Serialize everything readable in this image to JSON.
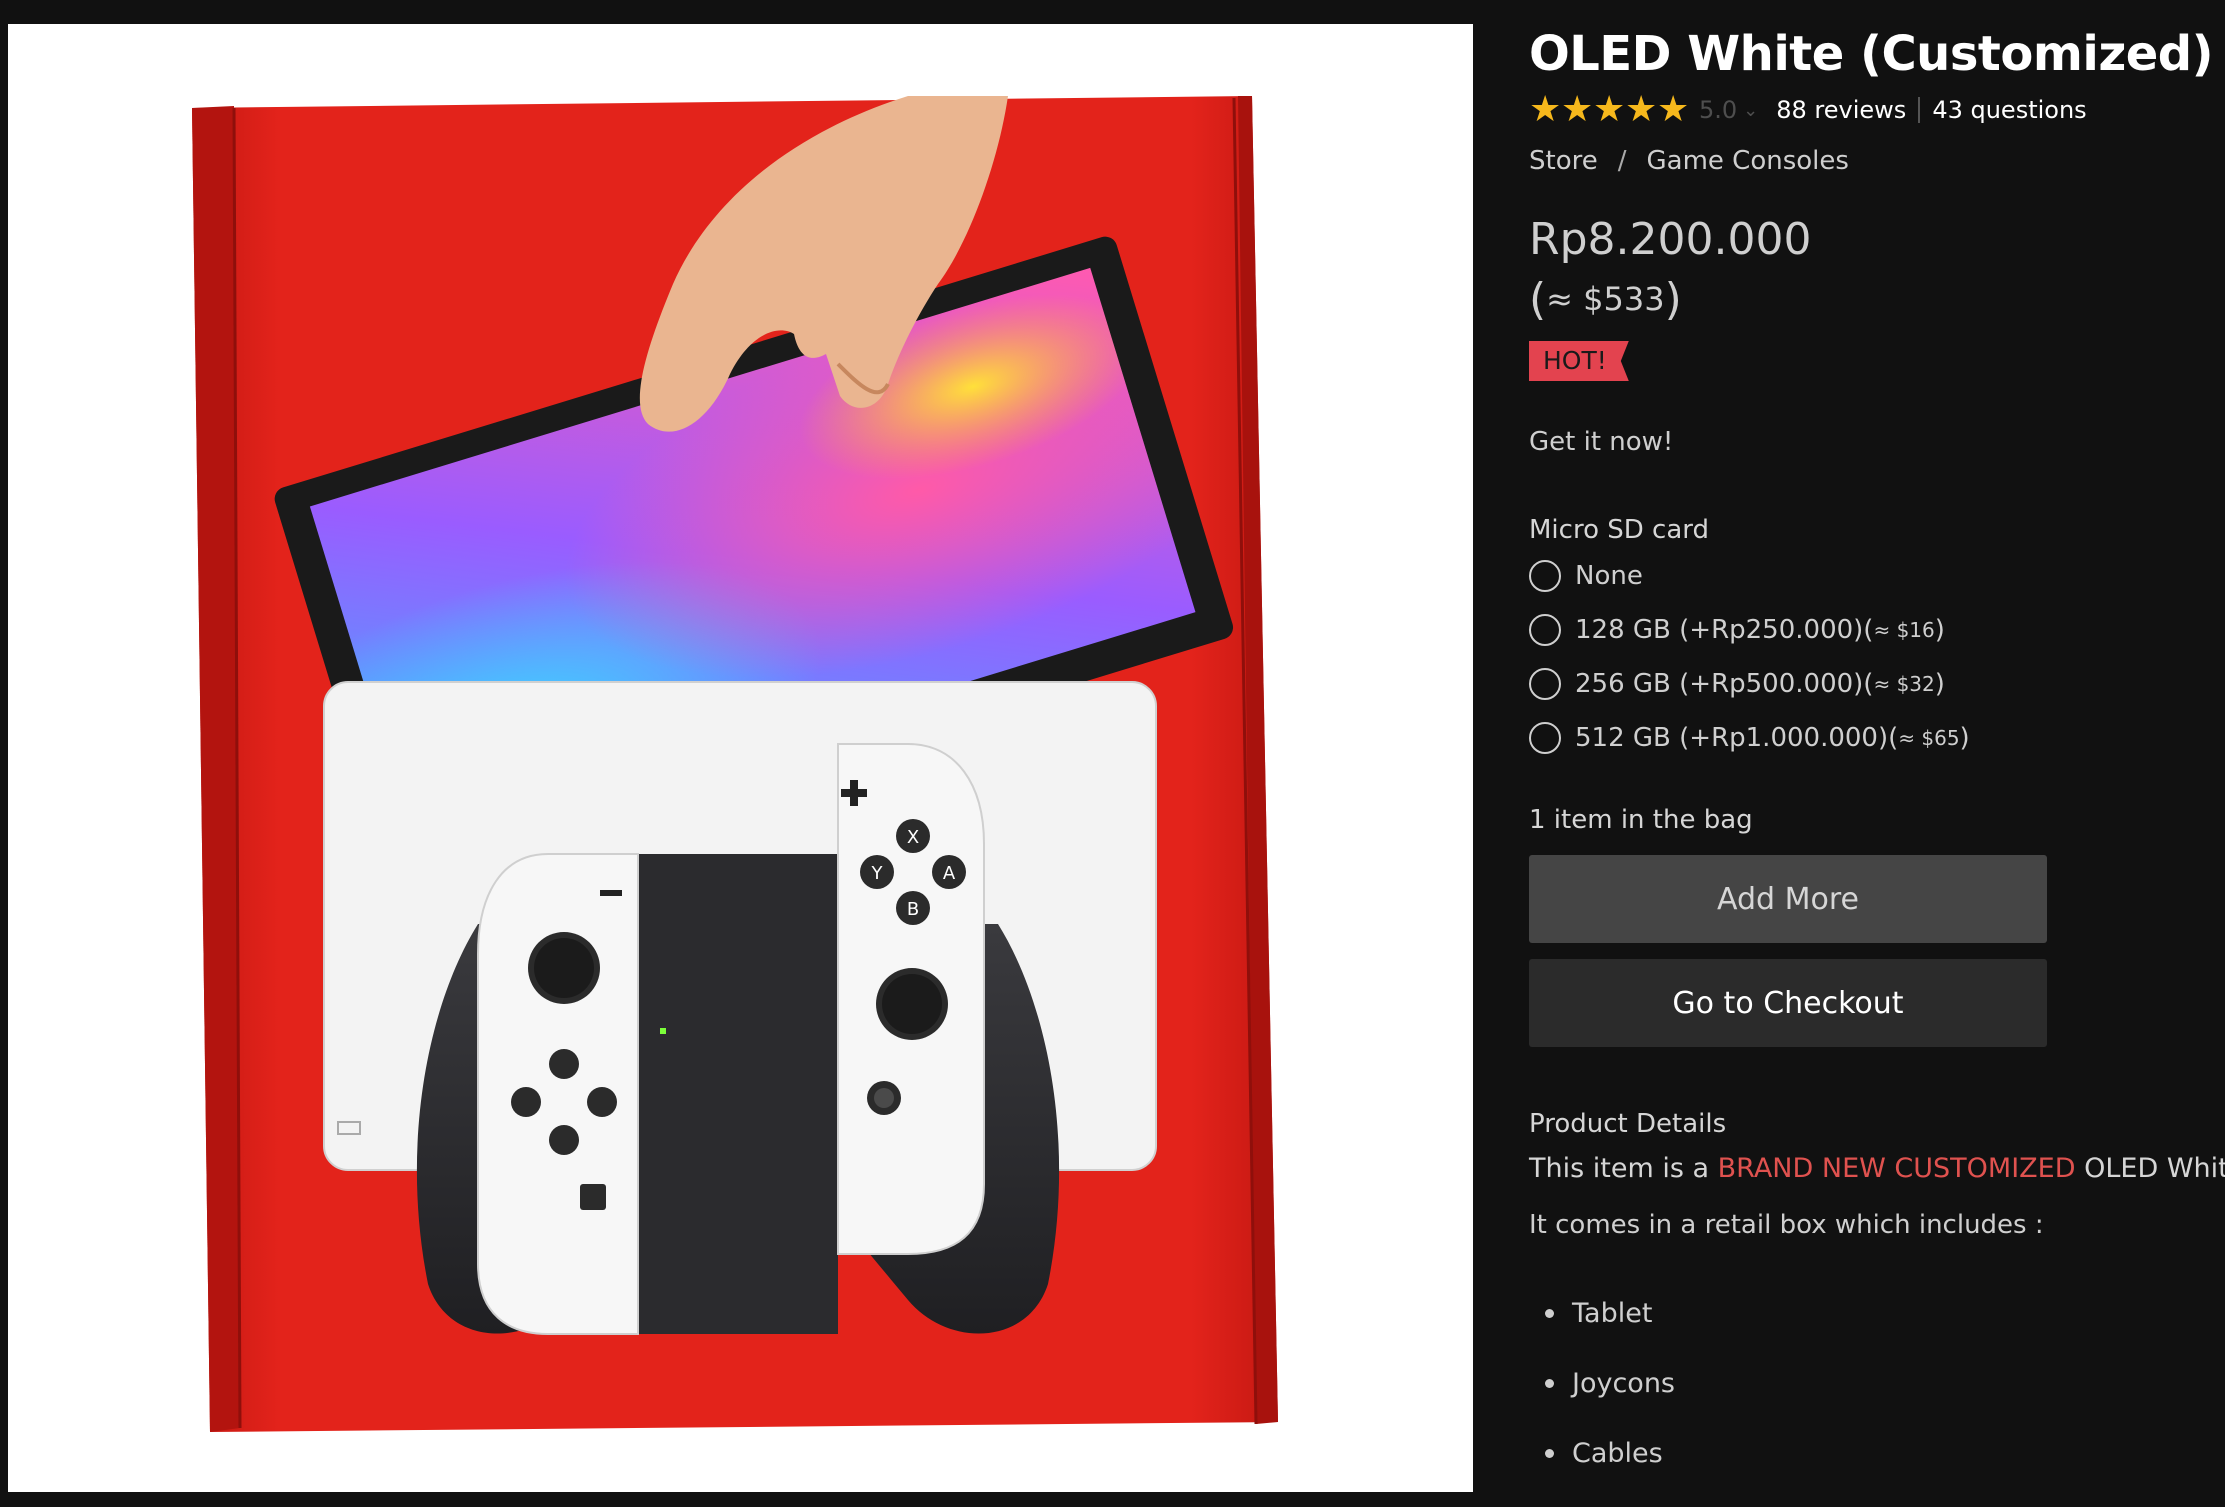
{
  "product": {
    "title": "OLED White (Customized)",
    "rating": {
      "stars_filled": 5,
      "stars_total": 5,
      "value": "5.0",
      "reviews": "88 reviews",
      "questions": "43 questions"
    },
    "breadcrumb": {
      "items": [
        "Store",
        "Game Consoles"
      ],
      "separator": "/"
    },
    "price": "Rp8.200.000",
    "price_usd": {
      "open": "(",
      "approx": "≈ $533",
      "close": ")"
    },
    "badge": "HOT!",
    "tagline": "Get it now!"
  },
  "options": {
    "title": "Micro SD card",
    "items": [
      {
        "label": "None",
        "usd": ""
      },
      {
        "label": "128 GB (+Rp250.000)(",
        "usd": "≈ $16",
        "close": ")"
      },
      {
        "label": "256 GB (+Rp500.000)(",
        "usd": "≈ $32",
        "close": ")"
      },
      {
        "label": "512 GB (+Rp1.000.000)(",
        "usd": "≈ $65",
        "close": ")"
      }
    ],
    "selected": null
  },
  "bag": {
    "count_text": "1 item in the bag",
    "add_more": "Add More",
    "checkout": "Go to Checkout"
  },
  "details": {
    "title": "Product Details",
    "line1_prefix": "This item is a",
    "line1_highlight": "BRAND NEW CUSTOMIZED",
    "line1_suffix": "OLED White.",
    "line2": "It comes in a retail box which includes :",
    "included": [
      "Tablet",
      "Joycons",
      "Cables"
    ]
  },
  "joycon_buttons": {
    "x": "X",
    "y": "Y",
    "a": "A",
    "b": "B"
  },
  "colors": {
    "background": "#111111",
    "star": "#f6b81c",
    "hot_badge": "#e3434f",
    "highlight": "#e0524f",
    "box_red": "#e3231b",
    "button_add": "#454545",
    "button_checkout": "#2b2b2b"
  }
}
